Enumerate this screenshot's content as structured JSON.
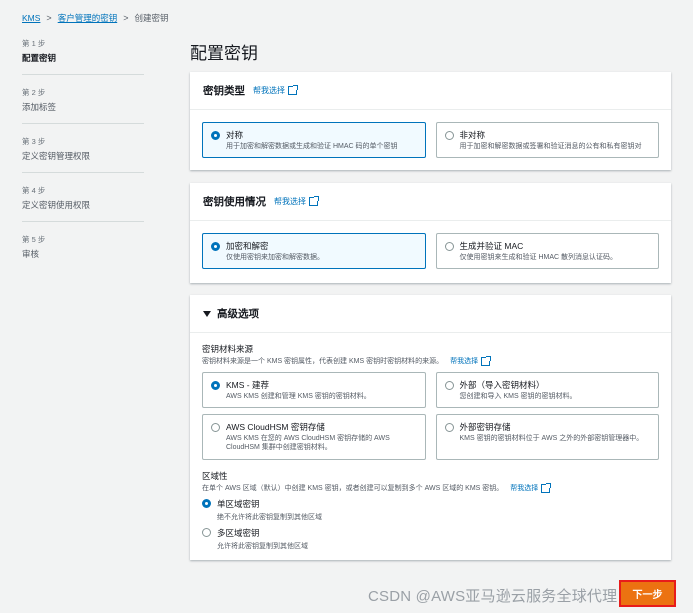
{
  "breadcrumb": {
    "items": [
      "KMS",
      "客户管理的密钥",
      "创建密钥"
    ],
    "separator": ">"
  },
  "steps": [
    {
      "num": "第 1 步",
      "name": "配置密钥"
    },
    {
      "num": "第 2 步",
      "name": "添加标签"
    },
    {
      "num": "第 3 步",
      "name": "定义密钥管理权限"
    },
    {
      "num": "第 4 步",
      "name": "定义密钥使用权限"
    },
    {
      "num": "第 5 步",
      "name": "审核"
    }
  ],
  "page_title": "配置密钥",
  "key_type": {
    "title": "密钥类型",
    "help": "帮我选择",
    "options": [
      {
        "title": "对称",
        "desc": "用于加密和解密数据或生成和验证 HMAC 码的单个密钥",
        "selected": true
      },
      {
        "title": "非对称",
        "desc": "用于加密和解密数据或签署和验证消息的公有和私有密钥对",
        "selected": false
      }
    ]
  },
  "key_usage": {
    "title": "密钥使用情况",
    "help": "帮我选择",
    "options": [
      {
        "title": "加密和解密",
        "desc": "仅使用密钥来加密和解密数据。",
        "selected": true
      },
      {
        "title": "生成并验证 MAC",
        "desc": "仅使用密钥来生成和验证 HMAC 散列消息认证码。",
        "selected": false
      }
    ]
  },
  "advanced": {
    "title": "高级选项",
    "origin_label": "密钥材料来源",
    "origin_desc": "密钥材料来源是一个 KMS 密钥属性，代表创建 KMS 密钥时密钥材料的来源。",
    "origin_help": "帮我选择",
    "origins": [
      {
        "title": "KMS - 建荐",
        "desc": "AWS KMS 创建和管理 KMS 密钥的密钥材料。",
        "selected": true
      },
      {
        "title": "外部（导入密钥材料）",
        "desc": "您创建和导入 KMS 密钥的密钥材料。",
        "selected": false
      },
      {
        "title": "AWS CloudHSM 密钥存储",
        "desc": "AWS KMS 在您的 AWS CloudHSM 密钥存储的 AWS CloudHSM 集群中创建密钥材料。",
        "selected": false
      },
      {
        "title": "外部密钥存储",
        "desc": "KMS 密钥的密钥材料位于 AWS 之外的外部密钥管理器中。",
        "selected": false
      }
    ],
    "region_label": "区域性",
    "region_desc": "在单个 AWS 区域（默认）中创建 KMS 密钥，或者创建可以复制到多个 AWS 区域的 KMS 密钥。",
    "region_help": "帮我选择",
    "regions": [
      {
        "title": "单区域密钥",
        "desc": "绝不允许将此密钥复制到其他区域",
        "selected": true
      },
      {
        "title": "多区域密钥",
        "desc": "允许将此密钥复制到其他区域",
        "selected": false
      }
    ]
  },
  "watermark": "CSDN @AWS亚马逊云服务全球代理",
  "next_button": "下一步"
}
